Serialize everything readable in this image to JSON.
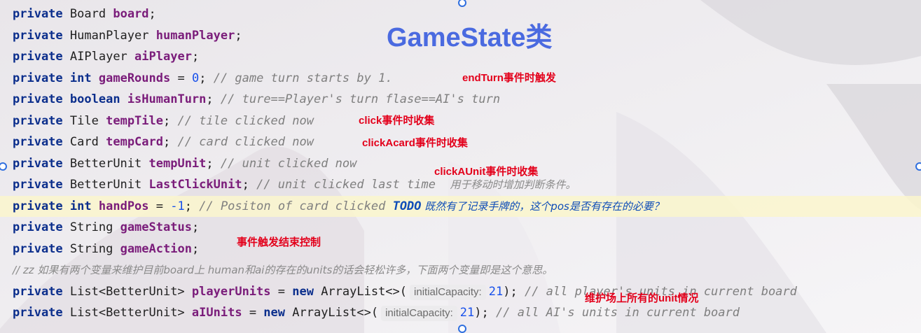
{
  "title": "GameState类",
  "code": {
    "board": {
      "kw": "private",
      "type": "Board",
      "name": "board",
      "end": ";"
    },
    "human": {
      "kw": "private",
      "type": "HumanPlayer",
      "name": "humanPlayer",
      "end": ";"
    },
    "ai": {
      "kw": "private",
      "type": "AIPlayer",
      "name": "aiPlayer",
      "end": ";"
    },
    "rounds": {
      "kw": "private",
      "type": "int",
      "name": "gameRounds",
      "eq": " = ",
      "value": "0",
      "end": ";",
      "comment": "// game turn starts by 1."
    },
    "turn": {
      "kw": "private",
      "type": "boolean",
      "name": "isHumanTurn",
      "end": ";",
      "comment": "// ture==Player's turn flase==AI's turn"
    },
    "tile": {
      "kw": "private",
      "type": "Tile",
      "name": "tempTile",
      "end": ";",
      "comment": "// tile clicked now"
    },
    "card": {
      "kw": "private",
      "type": "Card",
      "name": "tempCard",
      "end": ";",
      "comment": "// card clicked now"
    },
    "unit": {
      "kw": "private",
      "type": "BetterUnit",
      "name": "tempUnit",
      "end": ";",
      "comment": "// unit clicked now"
    },
    "last": {
      "kw": "private",
      "type": "BetterUnit",
      "name": "LastClickUnit",
      "end": ";",
      "comment": "// unit clicked last time",
      "comment_cn": "用于移动时增加判断条件。"
    },
    "hand": {
      "kw": "private",
      "type": "int",
      "name": "handPos",
      "eq": " = ",
      "value": "-1",
      "end": ";",
      "comment": "// Positon of card clicked ",
      "todo": "TODO",
      "todo_cn": " 既然有了记录手牌的，这个pos是否有存在的必要？"
    },
    "status": {
      "kw": "private",
      "type": "String",
      "name": "gameStatus",
      "end": ";"
    },
    "action": {
      "kw": "private",
      "type": "String",
      "name": "gameAction",
      "end": ";"
    },
    "zz": {
      "comment": "// zz 如果有两个变量来维护目前board上 human和ai的存在的units的话会轻松许多，下面两个变量即是这个意思。"
    },
    "punits": {
      "kw": "private",
      "type": "List<BetterUnit>",
      "name": "playerUnits",
      "eq": " = ",
      "newkw": "new",
      "ctor": " ArrayList<>(",
      "hint": "initialCapacity:",
      "value": "21",
      "end": ");",
      "comment": "// all player's units in current board"
    },
    "aunits": {
      "kw": "private",
      "type": "List<BetterUnit>",
      "name": "aIUnits",
      "eq": " = ",
      "newkw": "new",
      "ctor": " ArrayList<>(",
      "hint": "initialCapacity:",
      "value": "21",
      "end": ");",
      "comment": "// all AI's units in current board"
    }
  },
  "annotations": {
    "endturn": "endTurn事件时触发",
    "click": "click事件时收集",
    "clickcard": "clickAcard事件时收集",
    "clickunit": "clickAUnit事件时收集",
    "control": "事件触发结束控制",
    "maintain": "维护场上所有的unit情况"
  }
}
